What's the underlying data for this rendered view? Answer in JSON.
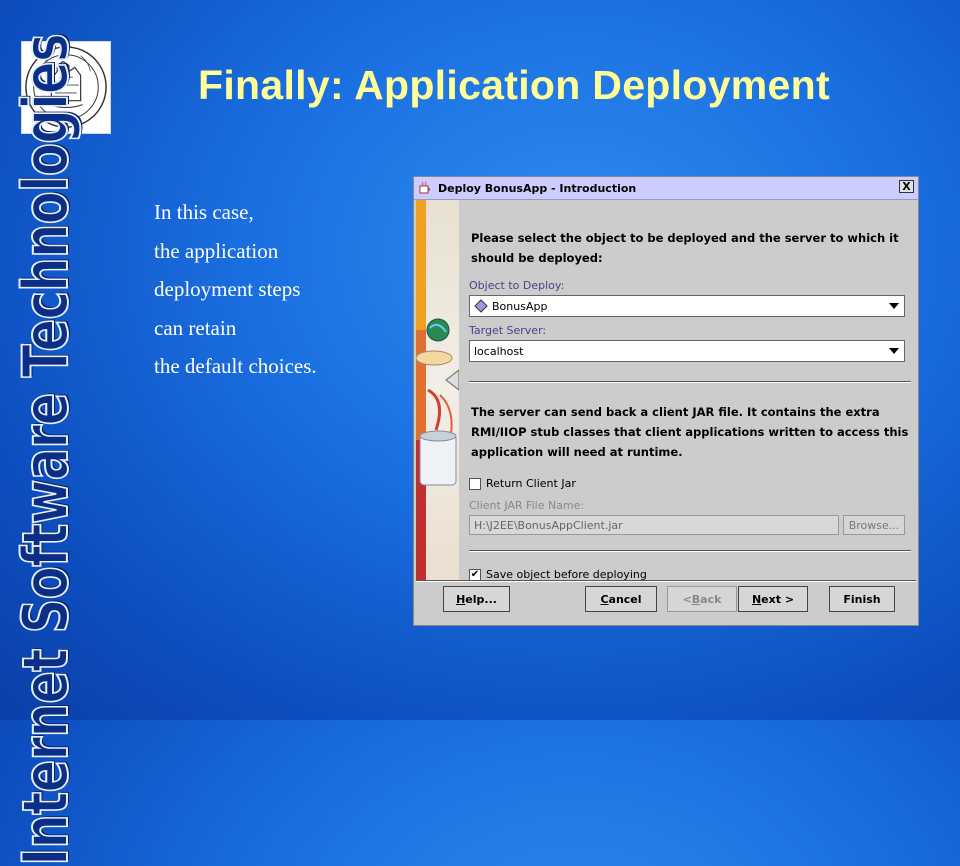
{
  "slide": {
    "title": "Finally: Application Deployment",
    "side_label": "Internet Software Technologies",
    "bullet_lines": [
      "In this case,",
      "the application",
      "deployment steps",
      "can retain",
      "the default choices."
    ],
    "logo_text": "PISA"
  },
  "dialog": {
    "title": "Deploy BonusApp - Introduction",
    "close_glyph": "X",
    "intro_line1": "Please select the object to be deployed and the server to which it",
    "intro_line2": "should be deployed:",
    "object_label": "Object to Deploy:",
    "object_value": "BonusApp",
    "server_label": "Target Server:",
    "server_value": "localhost",
    "jar_line1": "The server can send back a client JAR file. It contains the extra",
    "jar_line2": "RMI/IIOP stub classes that client applications written to access this",
    "jar_line3": "application will need at runtime.",
    "return_jar_label": "Return Client Jar",
    "return_jar_checked": false,
    "jar_name_label": "Client JAR File Name:",
    "jar_name_value": "H:\\J2EE\\BonusAppClient.jar",
    "browse_label": "Browse...",
    "save_label": "Save object before deploying",
    "save_checked": true,
    "buttons": {
      "help_pre": "",
      "help_u": "H",
      "help_post": "elp...",
      "cancel_pre": "",
      "cancel_u": "C",
      "cancel_post": "ancel",
      "back_pre": "< ",
      "back_u": "B",
      "back_post": "ack",
      "next_pre": "",
      "next_u": "N",
      "next_post": "ext >",
      "finish": "Finish"
    }
  },
  "colors": {
    "background": "#1a6fe0",
    "title": "#ffff99",
    "dialog_titlebar": "#ccccff",
    "dialog_body": "#cccccc"
  }
}
